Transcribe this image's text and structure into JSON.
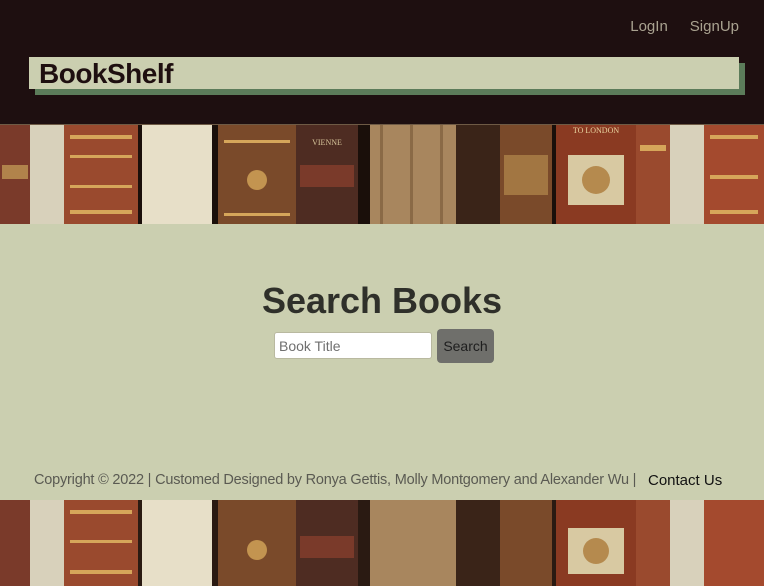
{
  "nav": {
    "login": "LogIn",
    "signup": "SignUp"
  },
  "brand": {
    "title": "BookShelf"
  },
  "search": {
    "heading": "Search Books",
    "placeholder": "Book Title",
    "button_label": "Search"
  },
  "footer": {
    "copyright": "Copyright © 2022 | Customed Designed by Ronya Gettis, Molly Montgomery and Alexander Wu |",
    "contact_label": "Contact Us"
  },
  "banner": {
    "spine_labels": [
      "VIENNE",
      "TO LONDON"
    ]
  },
  "colors": {
    "header_bg": "#1e0f10",
    "page_bg": "#cbcfb0",
    "brand_shadow": "#5c7c5a",
    "button_bg": "#6f6f6b"
  }
}
